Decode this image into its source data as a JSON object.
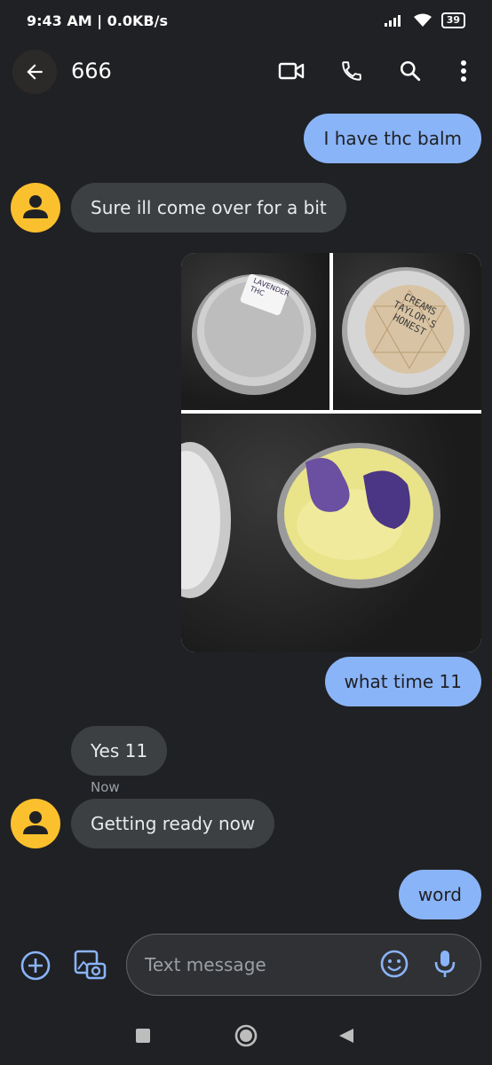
{
  "status": {
    "time": "9:43 AM | 0.0KB/s",
    "battery": "39"
  },
  "conversation": {
    "title": "666"
  },
  "messages": {
    "m1": "I have thc balm",
    "m2": "Sure ill come over for a bit",
    "m3": "what time 11",
    "m4": "Yes 11",
    "m4_time": "Now",
    "m5": "Getting ready now",
    "m6": "word"
  },
  "image": {
    "tin_label": "LAVENDER THC",
    "brand_line1": "CREAMS",
    "brand_line2": "TAYLOR'S",
    "brand_line3": "HONEST"
  },
  "compose": {
    "placeholder": "Text message"
  },
  "icons": [
    "back-arrow-icon",
    "video-call-icon",
    "phone-icon",
    "search-icon",
    "more-icon",
    "add-icon",
    "gallery-icon",
    "emoji-icon",
    "mic-icon",
    "recents-icon",
    "home-icon",
    "back-nav-icon"
  ],
  "colors": {
    "background": "#202124",
    "outgoing_bubble": "#8ab4f8",
    "incoming_bubble": "#3c4043",
    "avatar": "#fbc02d",
    "accent_icon": "#8ab4f8"
  }
}
